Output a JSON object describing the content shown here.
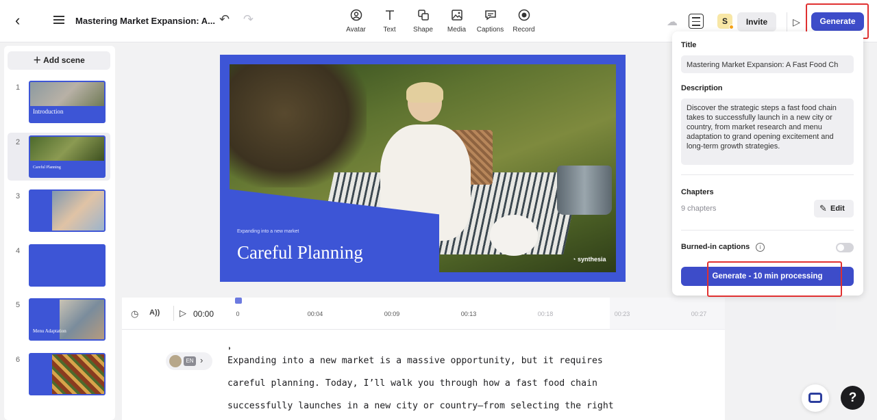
{
  "header": {
    "title": "Mastering Market Expansion: A...",
    "tools": [
      {
        "label": "Avatar",
        "icon": "avatar-icon"
      },
      {
        "label": "Text",
        "icon": "text-icon"
      },
      {
        "label": "Shape",
        "icon": "shape-icon"
      },
      {
        "label": "Media",
        "icon": "media-icon"
      },
      {
        "label": "Captions",
        "icon": "captions-icon"
      },
      {
        "label": "Record",
        "icon": "record-icon"
      }
    ],
    "user_initial": "S",
    "invite_label": "Invite",
    "generate_label": "Generate"
  },
  "sidebar": {
    "add_scene_label": "Add scene",
    "scenes": [
      {
        "number": "1",
        "caption": "Introduction"
      },
      {
        "number": "2",
        "caption": "Careful Planning"
      },
      {
        "number": "3",
        "caption": ""
      },
      {
        "number": "4",
        "caption": ""
      },
      {
        "number": "5",
        "caption": "Menu Adaptation"
      },
      {
        "number": "6",
        "caption": ""
      }
    ]
  },
  "canvas": {
    "subtitle": "Expanding into a new market",
    "title": "Careful Planning",
    "logo": "synthesia"
  },
  "timeline": {
    "current_time": "00:00",
    "ticks": [
      "0",
      "00:04",
      "00:09",
      "00:13",
      "00:18",
      "00:23",
      "00:27"
    ]
  },
  "script": {
    "language": "EN",
    "lines": [
      "Expanding into a new market is a massive opportunity, but it requires",
      "careful planning. Today, I’ll walk you through how a fast food chain",
      "successfully launches in a new city or country—from selecting the right"
    ]
  },
  "properties": {
    "title_label": "Title",
    "title_value": "Mastering Market Expansion: A Fast Food Ch",
    "description_label": "Description",
    "description_value": "Discover the strategic steps a fast food chain takes to successfully launch in a new city or country, from market research and menu adaptation to grand opening excitement and long-term growth strategies.",
    "chapters_label": "Chapters",
    "chapters_count": "9 chapters",
    "edit_label": "Edit",
    "captions_label": "Burned-in captions",
    "captions_enabled": false,
    "generate_label": "Generate - 10 min processing"
  },
  "colors": {
    "accent": "#3d4cc9",
    "canvas_blue": "#3d55d6",
    "highlight": "#e03030"
  }
}
